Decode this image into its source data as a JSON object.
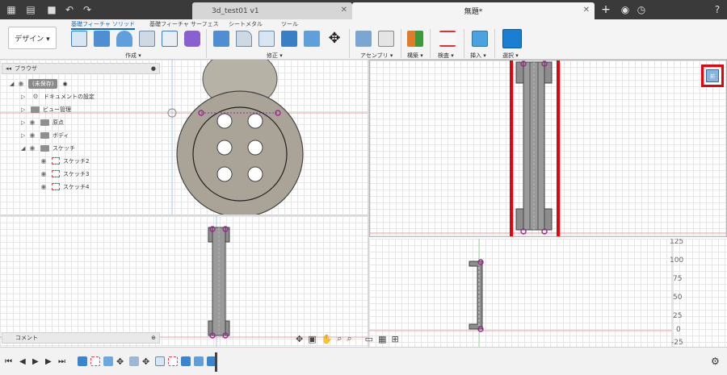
{
  "tabs": [
    {
      "label": "3d_test01 v1"
    },
    {
      "label": "無題*"
    }
  ],
  "toolbar": {
    "design_label": "デザイン ▾",
    "ribbon_tabs": [
      "基礎フィーチャ ソリッド",
      "基礎フィーチャ サーフェス",
      "シートメタル",
      "ツール"
    ],
    "groups": [
      "作成 ▾",
      "修正 ▾",
      "アセンブリ ▾",
      "構築 ▾",
      "検査 ▾",
      "挿入 ▾",
      "選択 ▾"
    ]
  },
  "browser": {
    "title": "ブラウザ",
    "items": [
      {
        "label": "(未保存)"
      },
      {
        "label": "ドキュメントの設定"
      },
      {
        "label": "ビュー管理"
      },
      {
        "label": "原点"
      },
      {
        "label": "ボディ"
      },
      {
        "label": "スケッチ"
      },
      {
        "label": "スケッチ2"
      },
      {
        "label": "スケッチ3"
      },
      {
        "label": "スケッチ4"
      }
    ]
  },
  "comment": {
    "label": "コメント"
  },
  "axis": {
    "labels": [
      "125",
      "100",
      "75",
      "50",
      "25",
      "0",
      "-25"
    ]
  },
  "colors": {
    "highlight": "#e8000b",
    "accent": "#0a6ebd",
    "body_fill": "#a9a497",
    "sketch_point": "#9b2a8f"
  }
}
